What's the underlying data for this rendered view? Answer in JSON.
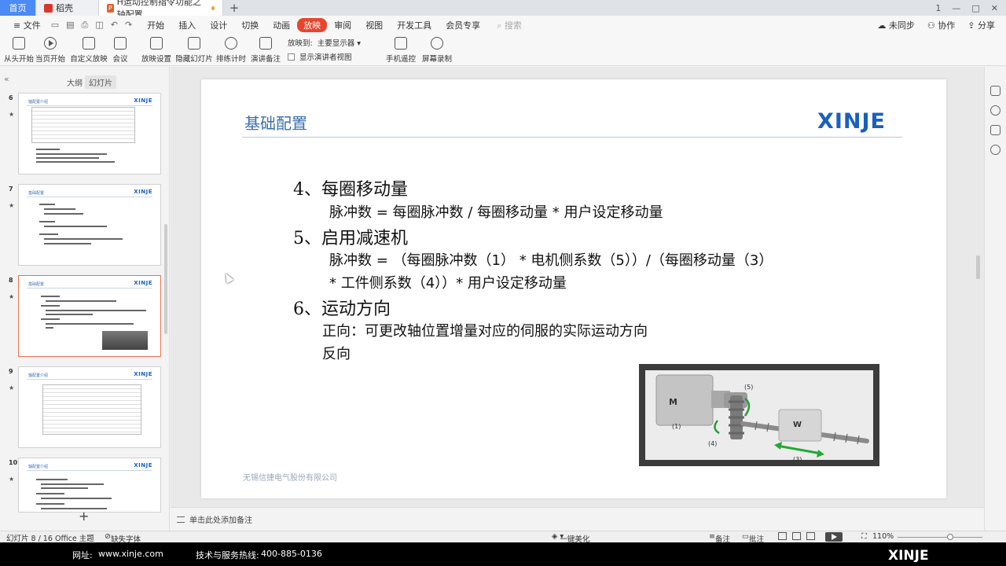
{
  "tabs": [
    {
      "label": "首页"
    },
    {
      "label": "稻壳"
    },
    {
      "label": "H运动控制指令功能之轴配置"
    }
  ],
  "window_controls": [
    "1",
    "—",
    "□",
    "✕"
  ],
  "menu": {
    "file": "文件",
    "items": [
      "开始",
      "插入",
      "设计",
      "切换",
      "动画",
      "放映",
      "审阅",
      "视图",
      "开发工具",
      "会员专享"
    ],
    "active": "放映",
    "search": "搜索",
    "right": [
      "未同步",
      "协作",
      "分享"
    ]
  },
  "ribbon": {
    "buttons": [
      "从头开始",
      "当页开始",
      "自定义放映",
      "会议",
      "放映设置",
      "隐藏幻灯片",
      "排练计时",
      "演讲备注"
    ],
    "show_to_label": "放映到:",
    "show_to_value": "主要显示器",
    "show_presenter_view": "显示演讲者视图",
    "remote": "手机遥控",
    "record": "屏幕录制"
  },
  "left_panel": {
    "tab_outline": "大纲",
    "tab_slides": "幻灯片",
    "slides": [
      {
        "num": "6",
        "title": "轴配置介绍"
      },
      {
        "num": "7",
        "title": "基础配置"
      },
      {
        "num": "8",
        "title": "基础配置"
      },
      {
        "num": "9",
        "title": "轴配置介绍"
      },
      {
        "num": "10",
        "title": "轴配置介绍"
      }
    ],
    "thumb_logo": "XINJE",
    "add_slide": "+"
  },
  "slide": {
    "title": "基础配置",
    "logo": "XINJE",
    "h4": "4、每圈移动量",
    "b4": "脉冲数 = 每圈脉冲数 / 每圈移动量 * 用户设定移动量",
    "h5": "5、启用减速机",
    "b5a": "脉冲数 = （每圈脉冲数（1） * 电机侧系数（5））/（每圈移动量（3）",
    "b5b": "* 工件侧系数（4））* 用户设定移动量",
    "h6": "6、运动方向",
    "b6a": "正向：可更改轴位置增量对应的伺服的实际运动方向",
    "b6b": "反向",
    "footer": "无锡信捷电气股份有限公司",
    "figure_labels": {
      "motor": "M",
      "work": "W",
      "l1": "(1)",
      "l3": "(3)",
      "l4": "(4)",
      "l5": "(5)"
    }
  },
  "notes_placeholder": "单击此处添加备注",
  "status": {
    "slide_index": "幻灯片 8 / 16",
    "theme": "Office 主题",
    "missing_font": "缺失字体",
    "beautify": "一键美化",
    "notes": "备注",
    "comments": "批注",
    "zoom": "110%"
  },
  "bottom_bar": {
    "website_label": "网址:",
    "website": "www.xinje.com",
    "hotline_label": "技术与服务热线:",
    "hotline": "400-885-0136",
    "logo": "XINJE"
  },
  "colors": {
    "accent": "#e8452c",
    "title_blue": "#3a6fb0",
    "logo_blue": "#1a5fc0"
  }
}
